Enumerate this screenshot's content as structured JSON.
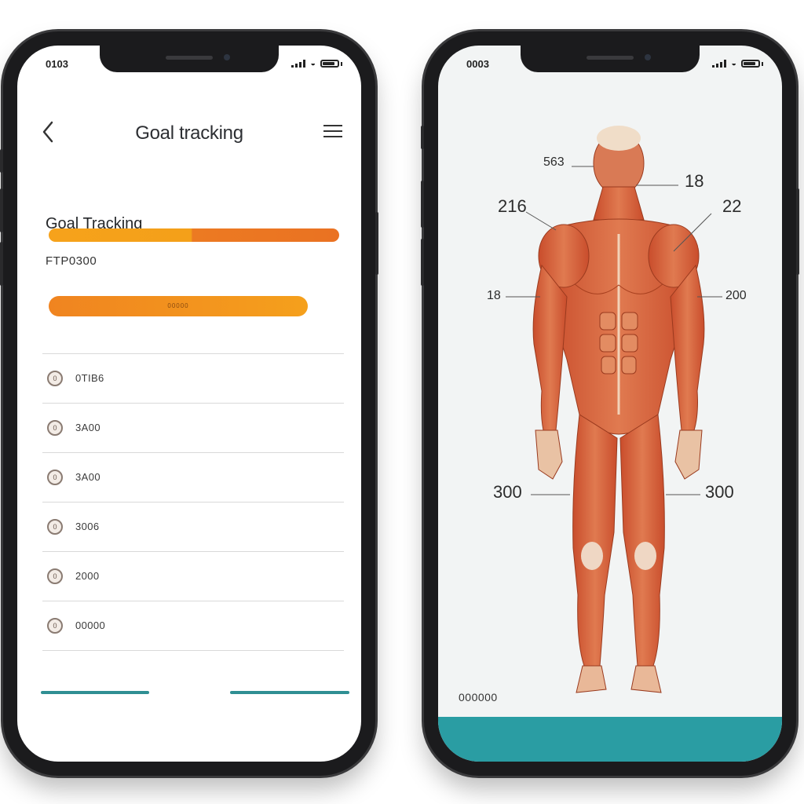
{
  "left_phone": {
    "status_time": "0103",
    "header": {
      "title": "Goal tracking"
    },
    "section_title": "Goal Tracking",
    "progress": {
      "value": 0.49
    },
    "subtext": "FTP0300",
    "pill_button": "00000",
    "items": [
      {
        "icon": "0",
        "label": "0TIB6"
      },
      {
        "icon": "0",
        "label": "3A00"
      },
      {
        "icon": "0",
        "label": "3A00"
      },
      {
        "icon": "0",
        "label": "3006"
      },
      {
        "icon": "0",
        "label": "2000"
      },
      {
        "icon": "0",
        "label": "00000"
      }
    ]
  },
  "right_phone": {
    "status_time": "0003",
    "annotations": {
      "head": "563",
      "neck": "18",
      "shoulder_left": "216",
      "shoulder_right": "22",
      "arm_left": "18",
      "arm_right": "200",
      "leg_left": "300",
      "leg_right": "300"
    },
    "caption": "000000"
  },
  "colors": {
    "orange_start": "#f6a21b",
    "orange_end": "#ea7222",
    "teal": "#2a9da3",
    "muscle": "#d9613a"
  }
}
